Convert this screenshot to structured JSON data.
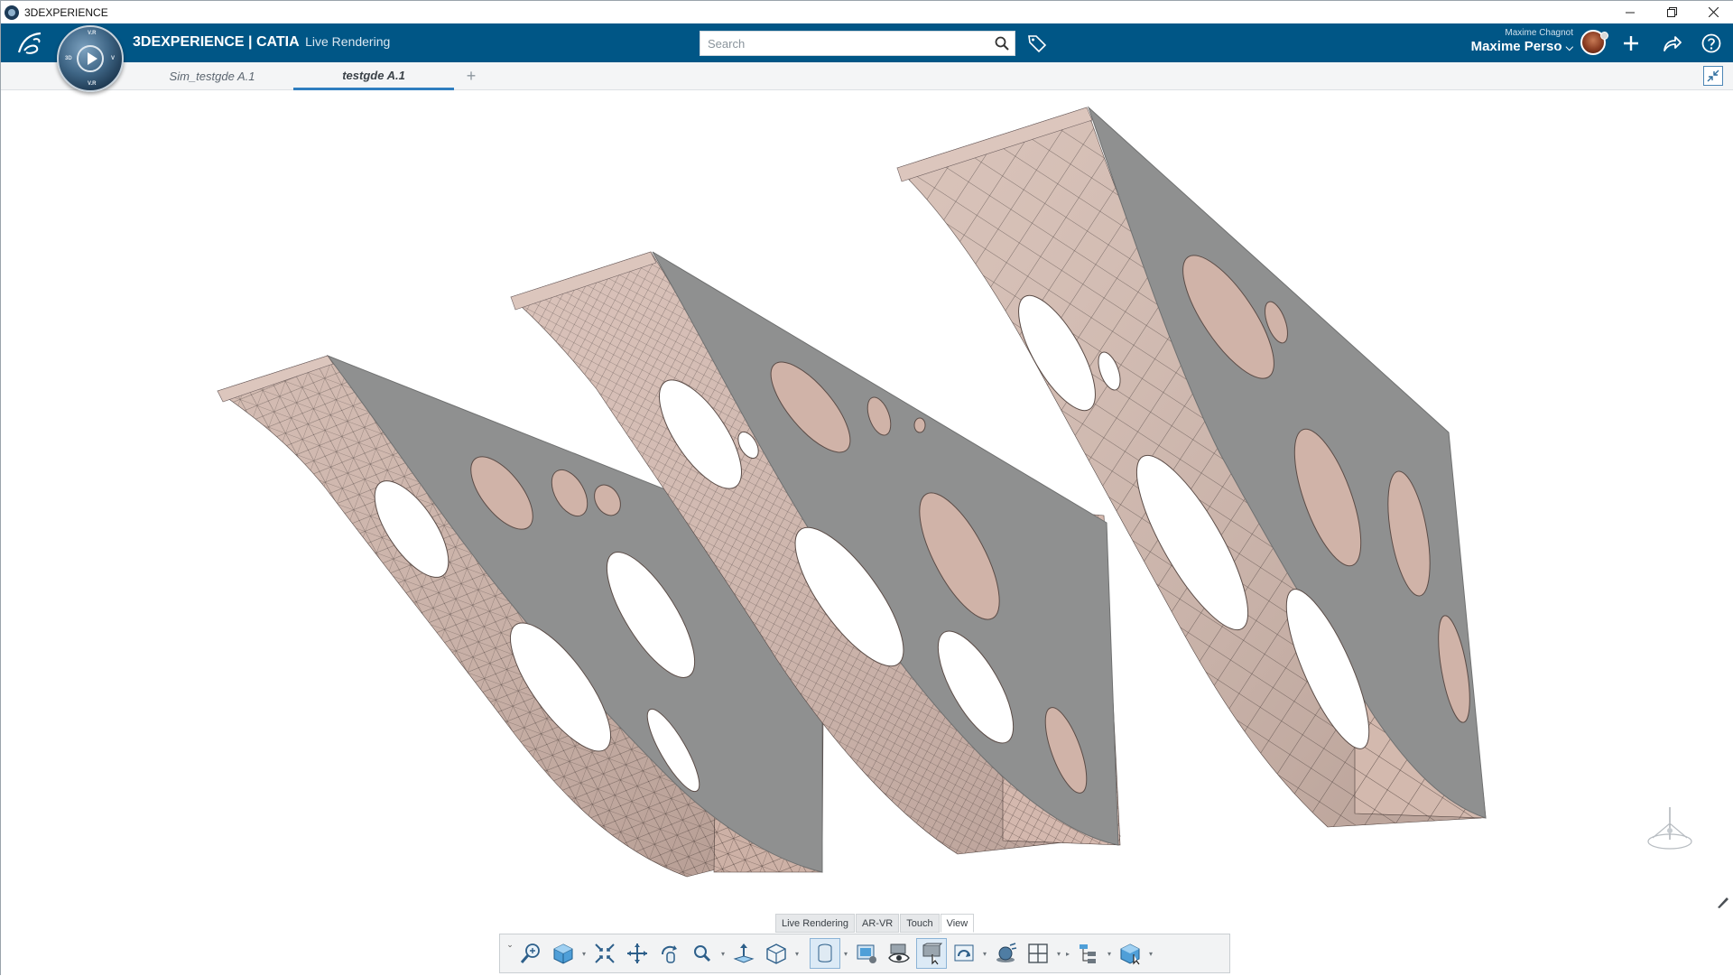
{
  "window": {
    "title": "3DEXPERIENCE"
  },
  "header": {
    "brand_bold": "3D",
    "brand_main": "EXPERIENCE | CATIA",
    "brand_sub": "Live Rendering",
    "search_placeholder": "Search",
    "user_small": "Maxime Chagnot",
    "user_main": "Maxime Perso",
    "compass_labels": {
      "top": "V.R",
      "left": "3D",
      "right": "V",
      "bottom": "V.R"
    }
  },
  "tabs": [
    {
      "label": "Sim_testgde A.1",
      "active": false
    },
    {
      "label": "testgde A.1",
      "active": true
    }
  ],
  "tab_add_label": "+",
  "section_tabs": [
    {
      "label": "Live Rendering",
      "active": false
    },
    {
      "label": "AR-VR",
      "active": false
    },
    {
      "label": "Touch",
      "active": false
    },
    {
      "label": "View",
      "active": true
    }
  ],
  "toolbar_tools": [
    "zoom-area-icon",
    "view-cube-icon",
    "fit-all-icon",
    "pan-icon",
    "rotate-icon",
    "zoom-icon",
    "normal-view-icon",
    "multi-view-icon",
    "shading-icon",
    "rendering-settings-icon",
    "hide-show-icon",
    "swap-visible-icon",
    "ambience-icon",
    "lighting-icon",
    "window-layout-icon",
    "tree-icon",
    "specification-icon"
  ],
  "colors": {
    "header_bg": "#005686",
    "tab_active_underline": "#2f7ec0",
    "model_top_face": "#8f9090",
    "model_mesh_face": "#d2b5aa",
    "viewport_bg": "#ffffff"
  }
}
